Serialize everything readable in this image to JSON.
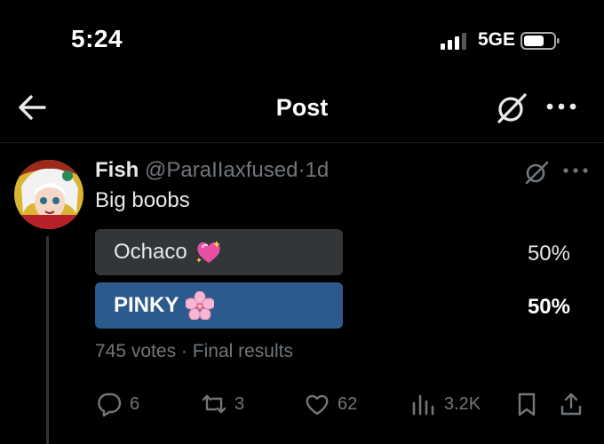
{
  "status_bar": {
    "time": "5:24",
    "network": "5GE"
  },
  "nav": {
    "title": "Post"
  },
  "post": {
    "author_name": "Fish",
    "author_handle": "@ParaIIaxfused",
    "separator": "·",
    "age": "1d",
    "text": "Big boobs",
    "poll": {
      "options": [
        {
          "label": "Ochaco",
          "emoji": "sparkling-heart-icon",
          "percent": "50%",
          "fill": 0.5,
          "winner": false
        },
        {
          "label": "PINKY",
          "emoji": "cherry-blossom-icon",
          "percent": "50%",
          "fill": 0.5,
          "winner": true
        }
      ],
      "votes": "745 votes",
      "meta_sep": "·",
      "status": "Final results"
    },
    "actions": {
      "replies": "6",
      "reposts": "3",
      "likes": "62",
      "views": "3.2K"
    }
  },
  "colors": {
    "background": "#000000",
    "text": "#e7e9ea",
    "secondary": "#71767b",
    "poll_bar": "#333639",
    "poll_winner": "#2c5a8c"
  }
}
